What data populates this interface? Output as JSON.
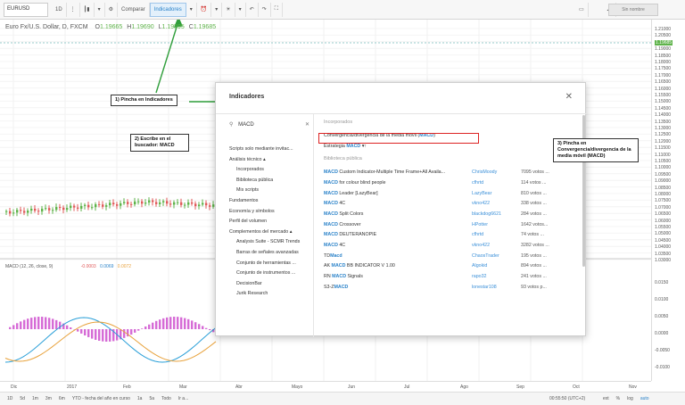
{
  "toolbar": {
    "symbol": "EURUSD",
    "interval": "1D",
    "compare": "Comparar",
    "indicators": "Indicadores",
    "search_right": "Sin nombre"
  },
  "legend": {
    "title": "Euro Fx/U.S. Dollar, D, FXCM",
    "o": "O",
    "o_val": "1.19665",
    "h": "H",
    "h_val": "1.19690",
    "l": "L",
    "l_val": "1.19595",
    "c": "C",
    "c_val": "1.19685"
  },
  "macd_legend": {
    "label": "MACD (12, 26, close, 9)",
    "v1": "-0.0003",
    "v2": "0.0069",
    "v3": "0.0072"
  },
  "price_axis": [
    "1.21000",
    "1.20500",
    "1.19685",
    "1.19000",
    "1.18500",
    "1.18000",
    "1.17500",
    "1.17000",
    "1.16500",
    "1.16000",
    "1.15500",
    "1.15000",
    "1.14500",
    "1.14000",
    "1.13500",
    "1.13000",
    "1.12500",
    "1.12000",
    "1.11500",
    "1.11000",
    "1.10500",
    "1.10000",
    "1.09500",
    "1.09000",
    "1.08500",
    "1.08000",
    "1.07500",
    "1.07000",
    "1.06500",
    "1.06000",
    "1.05500",
    "1.05000",
    "1.04500",
    "1.04000",
    "1.03500",
    "1.03000"
  ],
  "macd_axis": [
    "0.0150",
    "0.0100",
    "0.0050",
    "0.0000",
    "-0.0050",
    "-0.0100"
  ],
  "time_axis": [
    "Dic",
    "2017",
    "Feb",
    "Mar",
    "Abr",
    "Mayo",
    "Jun",
    "Jul",
    "Ago",
    "Sep",
    "Oct",
    "Nov"
  ],
  "bottombar": {
    "ranges": [
      "1D",
      "5d",
      "1m",
      "3m",
      "6m",
      "YTD - fecha del año en curso",
      "1a",
      "5a",
      "Todo",
      "Ir a..."
    ],
    "clock": "00:55:50 (UTC+2)",
    "opts": [
      "ext",
      "%",
      "log",
      "auto"
    ]
  },
  "dialog": {
    "title": "Indicadores",
    "search_value": "MACD",
    "nav": [
      {
        "label": "Scripts solo mediante invitac...",
        "sub": false
      },
      {
        "label": "Análisis técnico ▴",
        "sub": false
      },
      {
        "label": "Incorporados",
        "sub": true
      },
      {
        "label": "Biblioteca pública",
        "sub": true
      },
      {
        "label": "Mis scripts",
        "sub": true
      },
      {
        "label": "Fundamentos",
        "sub": false
      },
      {
        "label": "Economía y símbolos",
        "sub": false
      },
      {
        "label": "Perfil del volumen",
        "sub": false
      },
      {
        "label": "Complementos del mercado ▴",
        "sub": false
      },
      {
        "label": "Analysis Suite - SCMR Trends",
        "sub": true
      },
      {
        "label": "Barras de señales avanzadas",
        "sub": true
      },
      {
        "label": "Conjunto de herramientas ...",
        "sub": true
      },
      {
        "label": "Conjunto de instrumentos ...",
        "sub": true
      },
      {
        "label": "DecisionBar",
        "sub": true
      },
      {
        "label": "Jurik Research",
        "sub": true
      }
    ],
    "builtin_header": "Incorporados",
    "builtin": [
      {
        "pre": "Convergencia/divergencia de la media móvil (",
        "hl": "MACD",
        "post": ")"
      },
      {
        "pre": "Estrategia ",
        "hl": "MACD",
        "post": " ▾↑"
      }
    ],
    "public_header": "Biblioteca pública",
    "public": [
      {
        "hl": "MACD",
        "post": " Custom Indicator-Multiple Time Frame+All Availa...",
        "author": "ChrisMoody",
        "votes": "7095 votos ..."
      },
      {
        "hl": "MACD",
        "post": " for colour blind people",
        "author": "cfhrtd",
        "votes": "114 votos ..."
      },
      {
        "hl": "MACD",
        "post": " Leader [LazyBear]",
        "author": "LazyBear",
        "votes": "810 votos ..."
      },
      {
        "hl": "MACD",
        "post": " 4C",
        "author": "vkno422",
        "votes": "338 votos ..."
      },
      {
        "hl": "MACD",
        "post": " Split Colors",
        "author": "blackdog6621",
        "votes": "284 votos ..."
      },
      {
        "hl": "MACD",
        "post": " Crossover",
        "author": "HPotter",
        "votes": "1642 votos..."
      },
      {
        "hl": "MACD",
        "post": " DEUTERANOPIE",
        "author": "cfhrtd",
        "votes": "74 votos ..."
      },
      {
        "hl": "MACD",
        "post": " 4C",
        "author": "vkno422",
        "votes": "3282 votos ..."
      },
      {
        "pre": "TD",
        "hl": "Macd",
        "post": "",
        "author": "ChaosTrader",
        "votes": "195 votos ..."
      },
      {
        "pre": "AK ",
        "hl": "MACD",
        "post": " BB INDICATOR V 1.00",
        "author": "Algokid",
        "votes": "894 votos ..."
      },
      {
        "pre": "RN ",
        "hl": "MACD",
        "post": " Signals",
        "author": "rapo32",
        "votes": "241 votos ..."
      },
      {
        "pre": "S3-Z",
        "hl": "MACD",
        "post": "",
        "author": "lonestar108",
        "votes": "93 votos p..."
      }
    ]
  },
  "annotations": {
    "a1": "1) Pincha en Indicadores",
    "a2": "2) Escribe en el buscador: MACD",
    "a3": "3) Pincha en Convergencia/divergencia de la media móvil (MACD)"
  },
  "colors": {
    "accent": "#2a82c9",
    "up": "#5fb34b",
    "down": "#e05a5a",
    "annot_arrow": "#2f9e3b",
    "highlight_box": "#d22222"
  }
}
